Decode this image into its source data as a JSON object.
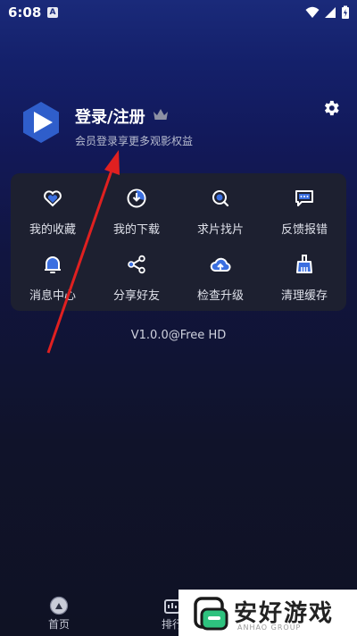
{
  "status": {
    "time": "6:08",
    "notif_letter": "A"
  },
  "profile": {
    "username": "登录/注册",
    "subtitle": "会员登录享更多观影权益"
  },
  "grid": [
    {
      "label": "我的收藏",
      "icon": "heart-icon"
    },
    {
      "label": "我的下载",
      "icon": "download-icon"
    },
    {
      "label": "求片找片",
      "icon": "search-icon"
    },
    {
      "label": "反馈报错",
      "icon": "feedback-icon"
    },
    {
      "label": "消息中心",
      "icon": "bell-icon"
    },
    {
      "label": "分享好友",
      "icon": "share-icon"
    },
    {
      "label": "检查升级",
      "icon": "cloud-upgrade-icon"
    },
    {
      "label": "清理缓存",
      "icon": "broom-icon"
    }
  ],
  "version": "V1.0.0@Free HD",
  "nav": [
    {
      "label": "首页",
      "icon": "home-icon"
    },
    {
      "label": "排行",
      "icon": "ranking-icon"
    }
  ],
  "watermark": {
    "text": "安好游戏",
    "sub": "ANHAO GROUP"
  },
  "colors": {
    "accent": "#3b6fe0",
    "card": "#1d2030",
    "arrow": "#e02020"
  }
}
